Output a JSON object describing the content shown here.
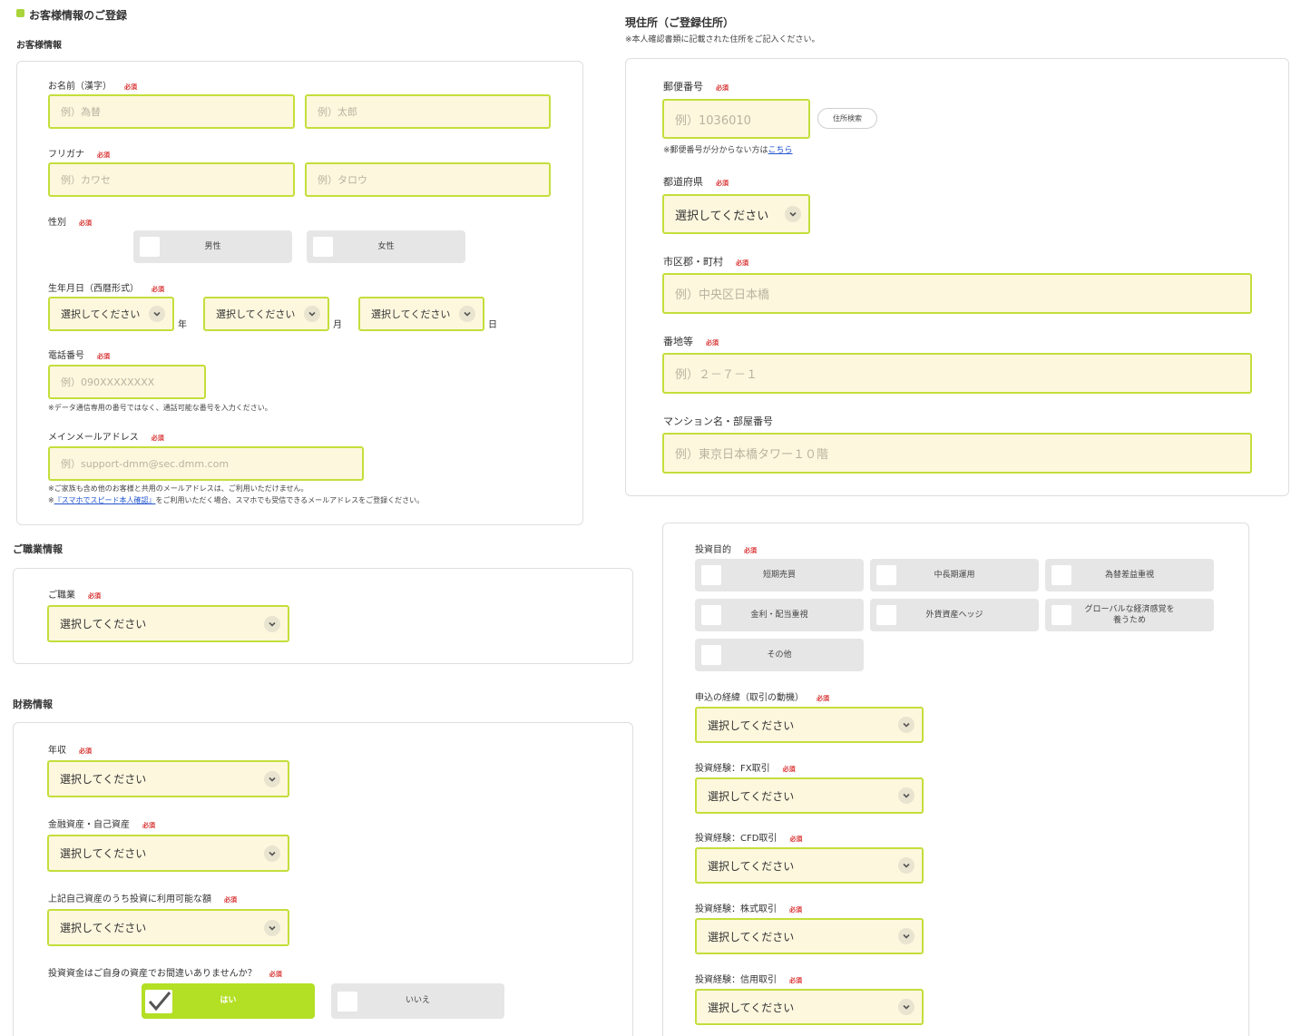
{
  "colors": {
    "accent": "#b3df24",
    "input_bg": "#fdf7de",
    "input_border": "#c4de3b",
    "required": "#d93232",
    "link": "#2255cc"
  },
  "header": {
    "title": "お客様情報のご登録"
  },
  "customer": {
    "section_title": "お客様情報",
    "required_label": "必須",
    "name": {
      "label": "お名前（漢字）",
      "last_placeholder": "例）為替",
      "first_placeholder": "例）太郎"
    },
    "kana": {
      "label": "フリガナ",
      "last_placeholder": "例）カワセ",
      "first_placeholder": "例）タロウ"
    },
    "gender": {
      "label": "性別",
      "male": "男性",
      "female": "女性"
    },
    "birthday": {
      "label": "生年月日（西暦形式）",
      "year_select": "選択してください",
      "month_select": "選択してください",
      "day_select": "選択してください",
      "year_unit": "年",
      "month_unit": "月",
      "day_unit": "日"
    },
    "phone": {
      "label": "電話番号",
      "placeholder": "例）090XXXXXXXX",
      "note": "※データ通信専用の番号ではなく、通話可能な番号を入力ください。"
    },
    "email": {
      "label": "メインメールアドレス",
      "placeholder": "例）support-dmm@sec.dmm.com",
      "note1": "※ご家族も含め他のお客様と共用のメールアドレスは、ご利用いただけません。",
      "note2_prefix": "※",
      "note2_link": "『スマホでスピード本人確認』",
      "note2_suffix": "をご利用いただく場合、スマホでも受信できるメールアドレスをご登録ください。"
    }
  },
  "address": {
    "title": "現住所（ご登録住所）",
    "note": "※本人確認書類に記載された住所をご記入ください。",
    "postal": {
      "label": "郵便番号",
      "placeholder": "例）1036010",
      "search_button": "住所検索",
      "note_prefix": "※郵便番号が分からない方は",
      "note_link": "こちら"
    },
    "prefecture": {
      "label": "都道府県",
      "select": "選択してください"
    },
    "city": {
      "label": "市区郡・町村",
      "placeholder": "例）中央区日本橋"
    },
    "street": {
      "label": "番地等",
      "placeholder": "例）２－７－１"
    },
    "building": {
      "label": "マンション名・部屋番号",
      "placeholder": "例）東京日本橋タワー１０階"
    }
  },
  "occupation": {
    "section_title": "ご職業情報",
    "label": "ご職業",
    "select": "選択してください"
  },
  "finance": {
    "section_title": "財務情報",
    "income": {
      "label": "年収",
      "select": "選択してください"
    },
    "assets": {
      "label": "金融資産・自己資産",
      "select": "選択してください"
    },
    "investable": {
      "label": "上記自己資産のうち投資に利用可能な額",
      "select": "選択してください"
    },
    "own_funds": {
      "label": "投資資金はご自身の資産でお間違いありませんか？",
      "yes": "はい",
      "no": "いいえ"
    }
  },
  "investment": {
    "purpose": {
      "label": "投資目的",
      "options": [
        "短期売買",
        "中長期運用",
        "為替差益重視",
        "金利・配当重視",
        "外貨資産ヘッジ",
        "グローバルな経済感覚を\n養うため",
        "その他"
      ]
    },
    "motive": {
      "label": "申込の経緯（取引の動機）",
      "select": "選択してください"
    },
    "fx": {
      "label": "投資経験：FX取引",
      "select": "選択してください"
    },
    "cfd": {
      "label": "投資経験：CFD取引",
      "select": "選択してください"
    },
    "stock": {
      "label": "投資経験：株式取引",
      "select": "選択してください"
    },
    "margin": {
      "label": "投資経験：信用取引",
      "select": "選択してください"
    }
  }
}
